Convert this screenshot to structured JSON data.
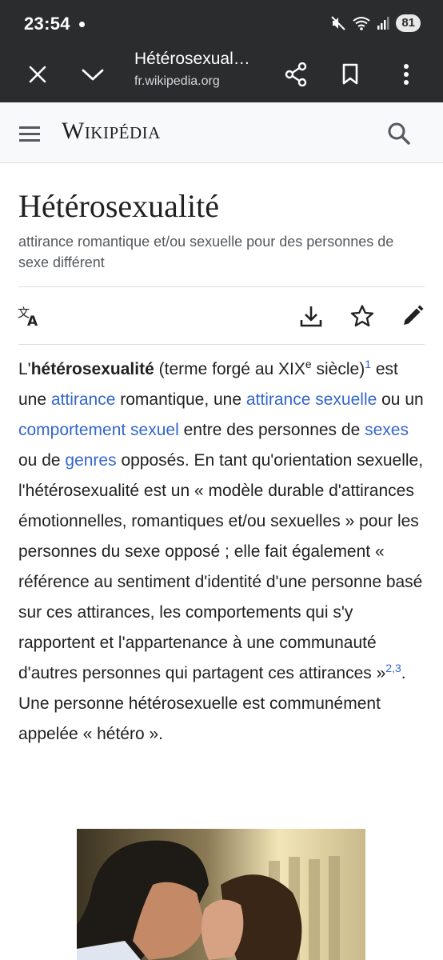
{
  "status": {
    "time": "23:54",
    "battery": "81",
    "icons": [
      "mute-icon",
      "wifi-icon",
      "signal-icon",
      "battery-icon"
    ]
  },
  "toolbar": {
    "title": "Hétérosexual…",
    "url": "fr.wikipedia.org",
    "icons": [
      "close-icon",
      "chevron-down-icon",
      "share-icon",
      "bookmark-icon",
      "more-icon"
    ]
  },
  "wiki_header": {
    "logo": "Wikipédia",
    "icons": [
      "menu-icon",
      "search-icon"
    ]
  },
  "article": {
    "title": "Hétérosexualité",
    "subtitle": "attirance romantique et/ou sexuelle pour des personnes de sexe différent",
    "actions": [
      "translate-icon",
      "download-icon",
      "star-icon",
      "edit-icon"
    ],
    "paragraph": {
      "p1": "L'",
      "term": "hétérosexualité",
      "p2": " (terme forgé au XIX",
      "sup_e": "e",
      "p3": " siècle)",
      "ref1": "1",
      "p4": " est une ",
      "link_attirance": "attirance",
      "p5": " romantique, une ",
      "link_attirance_sexuelle": "attirance sexuelle",
      "p6": " ou un ",
      "link_comportement": "comportement sexuel",
      "p7": " entre des personnes de ",
      "link_sexes": "sexes",
      "p8": " ou de ",
      "link_genres": "genres",
      "p9": " opposés. En tant qu'orientation sexuelle, l'hétérosexualité est un « modèle durable d'attirances émotionnelles, romantiques et/ou sexuelles » pour les personnes du sexe opposé ; elle fait également « référence au sentiment d'identité d'une personne basé sur ces attirances, les comportements qui s'y rapportent et l'appartenance à une communauté d'autres personnes qui partagent ces attirances »",
      "ref23": "2,3",
      "p10": ". Une personne hétérosexuelle est communément appelée « hétéro »."
    }
  },
  "colors": {
    "link": "#3366cc",
    "toolbar_bg": "#2b2c2e",
    "header_bg": "#f8f9fa"
  }
}
